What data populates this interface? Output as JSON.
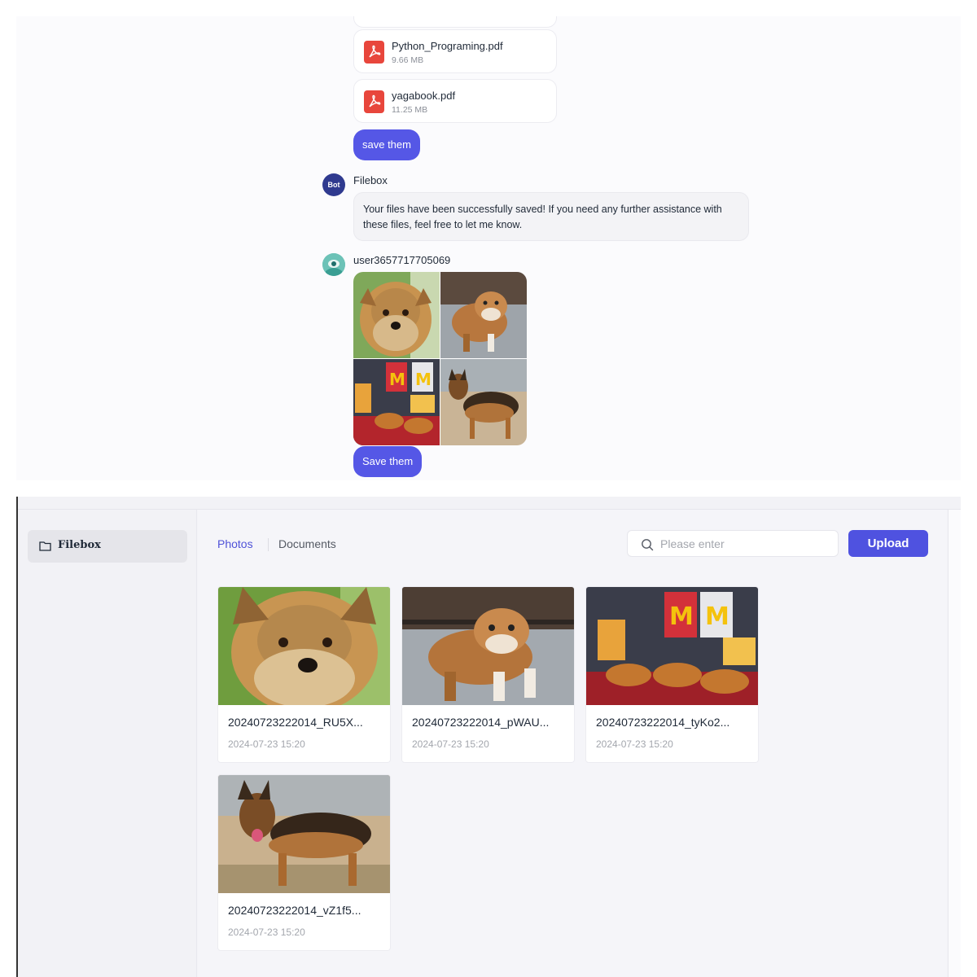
{
  "chat": {
    "files": [
      {
        "name": "Python_Programing.pdf",
        "size": "9.66 MB",
        "icon": "pdf-icon"
      },
      {
        "name": "yagabook.pdf",
        "size": "11.25 MB",
        "icon": "pdf-icon"
      }
    ],
    "save_them_label": "save them",
    "bot": {
      "avatar_text": "Bot",
      "name": "Filebox",
      "message": "Your files have been successfully saved! If you need any further assistance with these files, feel free to let me know."
    },
    "user": {
      "name": "user3657717705069"
    },
    "save_them_label_2": "Save them"
  },
  "app": {
    "sidebar": {
      "items": [
        {
          "label": "Filebox",
          "icon": "folder-icon"
        }
      ]
    },
    "tabs": [
      {
        "label": "Photos",
        "active": true
      },
      {
        "label": "Documents",
        "active": false
      }
    ],
    "search": {
      "placeholder": "Please enter"
    },
    "upload_label": "Upload",
    "photos": [
      {
        "name": "20240723222014_RU5X...",
        "date": "2024-07-23 15:20"
      },
      {
        "name": "20240723222014_pWAU...",
        "date": "2024-07-23 15:20"
      },
      {
        "name": "20240723222014_tyKo2...",
        "date": "2024-07-23 15:20"
      },
      {
        "name": "20240723222014_vZ1f5...",
        "date": "2024-07-23 15:20"
      }
    ]
  },
  "colors": {
    "accent": "#5557e6",
    "bot_avatar": "#2f3a8f",
    "pdf": "#e8463c"
  }
}
